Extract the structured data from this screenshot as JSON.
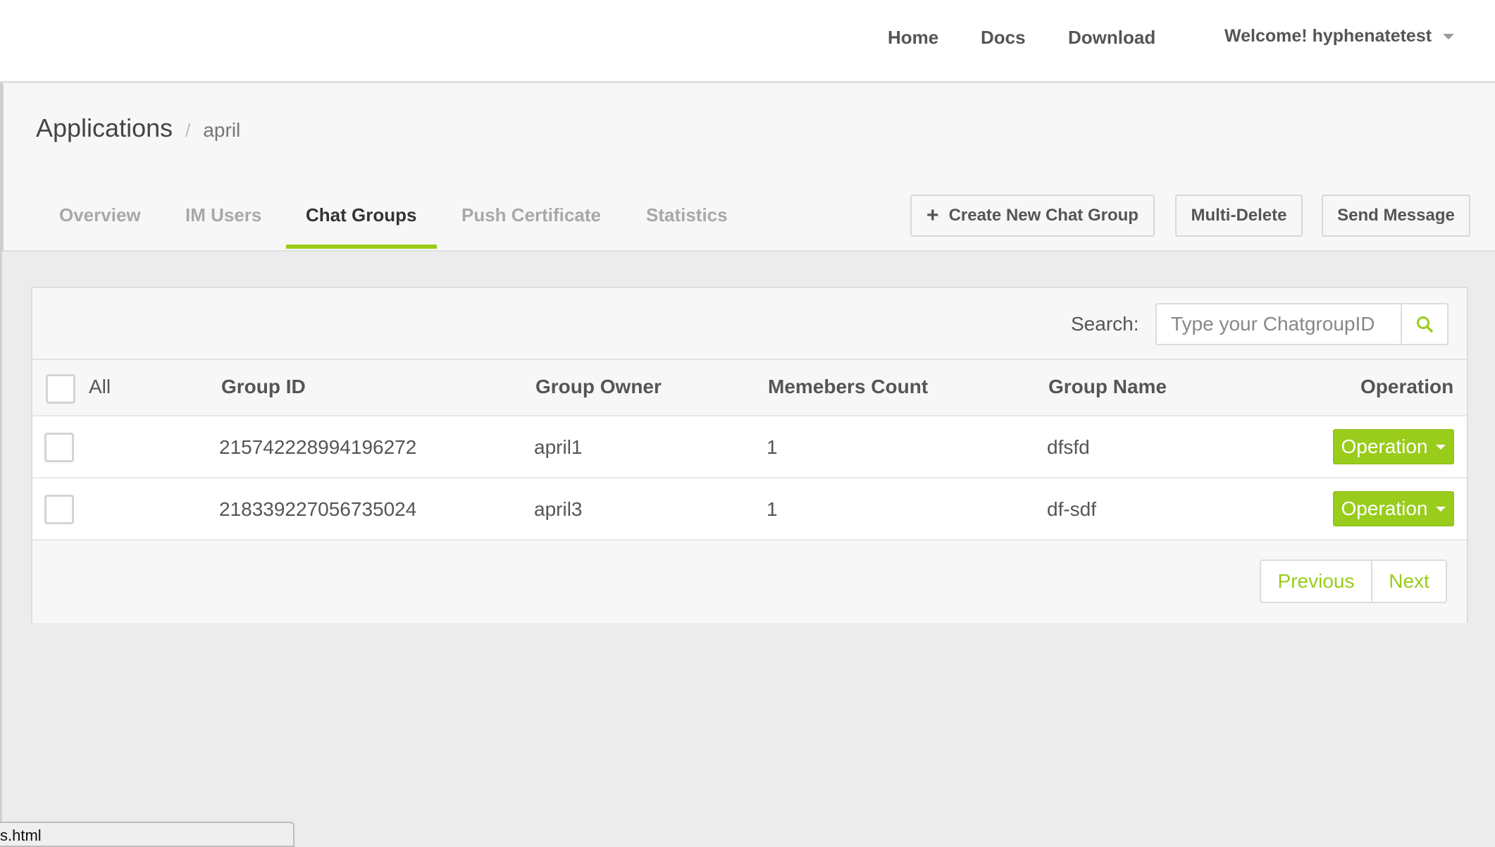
{
  "nav": {
    "links": [
      "Home",
      "Docs",
      "Download"
    ],
    "user_greeting": "Welcome! hyphenatetest"
  },
  "breadcrumb": {
    "title": "Applications",
    "separator": "/",
    "current": "april"
  },
  "tabs": [
    {
      "label": "Overview",
      "active": false
    },
    {
      "label": "IM Users",
      "active": false
    },
    {
      "label": "Chat Groups",
      "active": true
    },
    {
      "label": "Push Certificate",
      "active": false
    },
    {
      "label": "Statistics",
      "active": false
    }
  ],
  "actions": {
    "create_label": "Create New Chat Group",
    "multi_delete_label": "Multi-Delete",
    "send_message_label": "Send Message"
  },
  "search": {
    "label": "Search:",
    "placeholder": "Type your ChatgroupID"
  },
  "table": {
    "select_all_label": "All",
    "columns": [
      "Group ID",
      "Group Owner",
      "Memebers Count",
      "Group Name",
      "Operation"
    ],
    "rows": [
      {
        "group_id": "215742228994196272",
        "owner": "april1",
        "members": "1",
        "name": "dfsfd",
        "operation": "Operation"
      },
      {
        "group_id": "218339227056735024",
        "owner": "april3",
        "members": "1",
        "name": "df-sdf",
        "operation": "Operation"
      }
    ]
  },
  "pagination": {
    "previous": "Previous",
    "next": "Next"
  },
  "status_bar": {
    "url_text": "s.html"
  },
  "colors": {
    "accent": "#99cc1b",
    "background": "#ececec",
    "panel": "#f7f7f7"
  }
}
